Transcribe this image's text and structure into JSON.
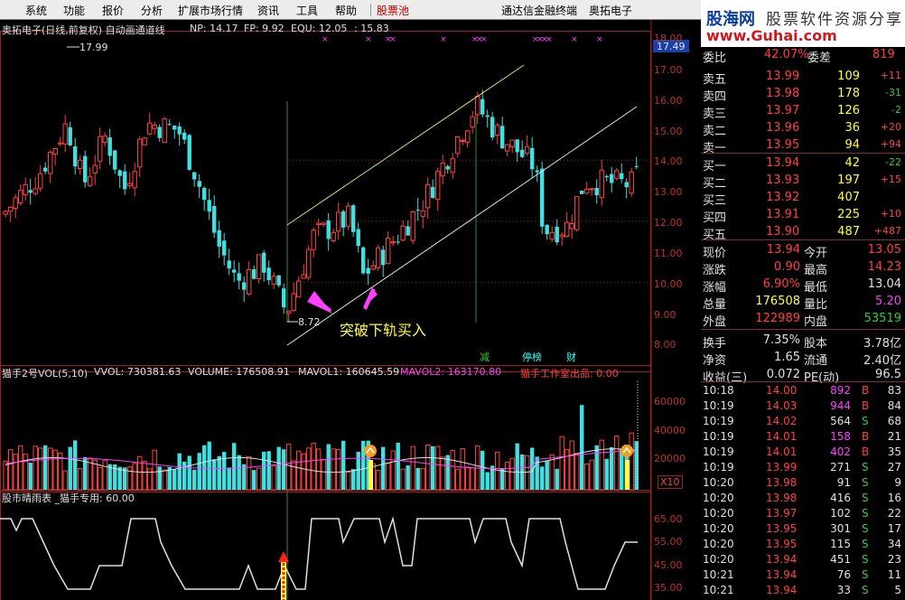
{
  "menu": {
    "items": [
      "系统",
      "功能",
      "报价",
      "分析",
      "扩展市场行情",
      "资讯",
      "工具",
      "帮助"
    ],
    "active_tab": "股票池",
    "app_title": "通达信金融终端",
    "stock_name": "奥拓电子"
  },
  "logo": {
    "site_cn": "股海网",
    "site_en": "www.Guhai.com",
    "slogan": "股票软件资源分享"
  },
  "kline": {
    "header": "奥拓电子(日线,前复权) 自动画通道线",
    "np": "NP: 14.17",
    "fp": "FP: 9.92",
    "equ": "EQU: 12.05",
    "extra": ": 15.83",
    "high_label": "17.99",
    "low_label": "8.72",
    "current_price": "17.49",
    "annotation": "突破下轨买入",
    "markers": [
      "减",
      "停榜",
      "财"
    ],
    "axis": [
      "18.00",
      "17.00",
      "16.00",
      "15.00",
      "14.00",
      "13.00",
      "12.00",
      "11.00",
      "10.00",
      "9.00",
      "8.00"
    ]
  },
  "volume": {
    "title": "猫手2号VOL(5,10)",
    "vvol": "VVOL: 730381.63",
    "volume": "VOLUME: 176508.91",
    "mavol1": "MAVOL1: 160645.59",
    "mavol2": "MAVOL2: 163170.80",
    "studio": "猫手工作室出品: 0.00",
    "axis": [
      "60000",
      "40000",
      "20000"
    ],
    "unit": "X10"
  },
  "indicator": {
    "title": "股市晴雨表 _猫手专用: 60.00",
    "axis": [
      "65.00",
      "55.00",
      "45.00",
      "35.00"
    ]
  },
  "orderbook": {
    "top": {
      "label": "委比",
      "value": "42.07%",
      "label2": "委差",
      "value2": "819"
    },
    "sells": [
      {
        "label": "卖五",
        "price": "13.99",
        "vol": "109",
        "chg": "+11"
      },
      {
        "label": "卖四",
        "price": "13.98",
        "vol": "178",
        "chg": "-31"
      },
      {
        "label": "卖三",
        "price": "13.97",
        "vol": "126",
        "chg": "-2"
      },
      {
        "label": "卖二",
        "price": "13.96",
        "vol": "36",
        "chg": "+20"
      },
      {
        "label": "卖一",
        "price": "13.95",
        "vol": "94",
        "chg": "+94"
      }
    ],
    "buys": [
      {
        "label": "买一",
        "price": "13.94",
        "vol": "42",
        "chg": "-22"
      },
      {
        "label": "买二",
        "price": "13.93",
        "vol": "197",
        "chg": "+15"
      },
      {
        "label": "买三",
        "price": "13.92",
        "vol": "407",
        "chg": ""
      },
      {
        "label": "买四",
        "price": "13.91",
        "vol": "225",
        "chg": "+10"
      },
      {
        "label": "买五",
        "price": "13.90",
        "vol": "487",
        "chg": "+487"
      }
    ]
  },
  "stats": [
    {
      "l1": "现价",
      "v1": "13.94",
      "l2": "今开",
      "v2": "13.05"
    },
    {
      "l1": "涨跌",
      "v1": "0.90",
      "l2": "最高",
      "v2": "14.23"
    },
    {
      "l1": "涨幅",
      "v1": "6.90%",
      "l2": "最低",
      "v2": "13.04"
    },
    {
      "l1": "总量",
      "v1": "176508",
      "l2": "量比",
      "v2": "5.20"
    },
    {
      "l1": "外盘",
      "v1": "122989",
      "l2": "内盘",
      "v2": "53519"
    },
    {
      "l1": "换手",
      "v1": "7.35%",
      "l2": "股本",
      "v2": "3.78亿"
    },
    {
      "l1": "净资",
      "v1": "1.65",
      "l2": "流通",
      "v2": "2.40亿"
    },
    {
      "l1": "收益(三)",
      "v1": "0.072",
      "l2": "PE(动)",
      "v2": "96.5"
    }
  ],
  "ticks": [
    {
      "t": "10:18",
      "p": "14.00",
      "v": "892",
      "bs": "B",
      "n": "83"
    },
    {
      "t": "10:19",
      "p": "14.03",
      "v": "944",
      "bs": "B",
      "n": "84"
    },
    {
      "t": "10:19",
      "p": "14.02",
      "v": "564",
      "bs": "S",
      "n": "68"
    },
    {
      "t": "10:19",
      "p": "14.01",
      "v": "158",
      "bs": "B",
      "n": "21"
    },
    {
      "t": "10:19",
      "p": "14.01",
      "v": "402",
      "bs": "B",
      "n": "35"
    },
    {
      "t": "10:19",
      "p": "13.99",
      "v": "271",
      "bs": "S",
      "n": "27"
    },
    {
      "t": "10:20",
      "p": "13.98",
      "v": "91",
      "bs": "S",
      "n": "9"
    },
    {
      "t": "10:20",
      "p": "13.98",
      "v": "416",
      "bs": "S",
      "n": "16"
    },
    {
      "t": "10:20",
      "p": "13.97",
      "v": "102",
      "bs": "S",
      "n": "22"
    },
    {
      "t": "10:20",
      "p": "13.95",
      "v": "301",
      "bs": "S",
      "n": "17"
    },
    {
      "t": "10:20",
      "p": "13.95",
      "v": "115",
      "bs": "S",
      "n": "34"
    },
    {
      "t": "10:20",
      "p": "13.94",
      "v": "451",
      "bs": "S",
      "n": "23"
    },
    {
      "t": "10:21",
      "p": "13.94",
      "v": "76",
      "bs": "S",
      "n": "11"
    },
    {
      "t": "10:21",
      "p": "13.94",
      "v": "33",
      "bs": "S",
      "n": "5"
    }
  ],
  "colors": {
    "up": "#ff4040",
    "down": "#40e0e0",
    "border": "#a02020"
  }
}
